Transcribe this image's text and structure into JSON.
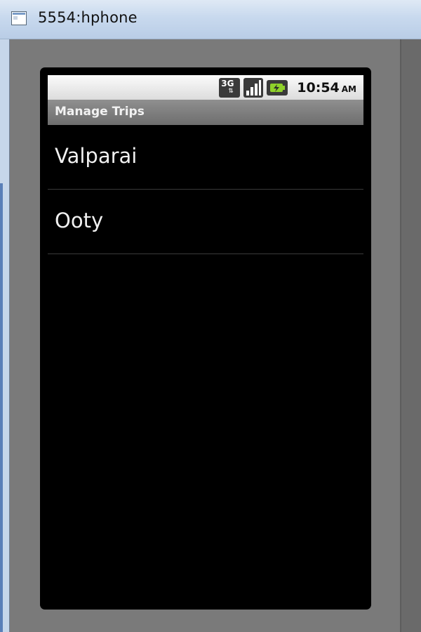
{
  "window": {
    "title": "5554:hphone",
    "app_icon": "window-app-icon"
  },
  "status_bar": {
    "network_type": "3G",
    "network_icon": "3g-data-icon",
    "signal_icon": "signal-strength-icon",
    "battery_icon": "battery-icon",
    "time": "10:54",
    "ampm": "AM"
  },
  "app": {
    "title": "Manage Trips"
  },
  "trips": {
    "items": [
      {
        "label": "Valparai"
      },
      {
        "label": "Ooty"
      }
    ]
  },
  "colors": {
    "screen_bg": "#000000",
    "title_bar_bg": "#7d7d7d",
    "emulator_bg": "#7a7a7a"
  }
}
